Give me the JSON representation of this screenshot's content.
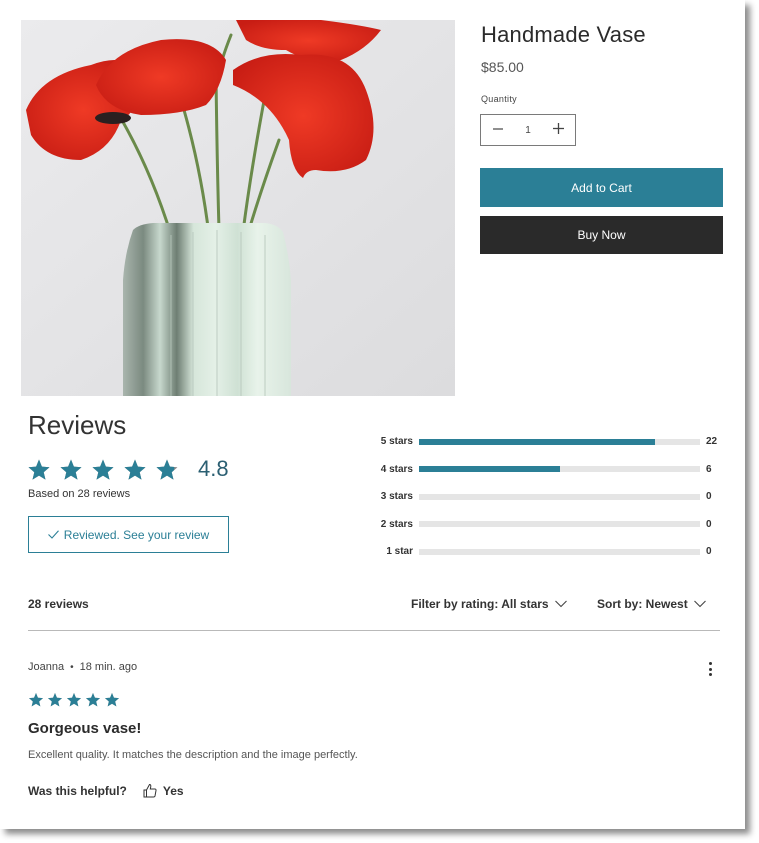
{
  "product": {
    "image_alt": "Red poppies in a pale green ribbed ceramic vase",
    "title": "Handmade Vase",
    "price": "$85.00",
    "quantity_label": "Quantity",
    "quantity_value": "1",
    "decrement_icon": "minus-icon",
    "increment_icon": "plus-icon",
    "add_to_cart_label": "Add to Cart",
    "buy_now_label": "Buy Now"
  },
  "reviews_summary": {
    "heading": "Reviews",
    "average_rating": "4.8",
    "average_rating_value": 4.8,
    "max_rating": 5,
    "based_on": "Based on 28 reviews",
    "reviewed_button_label": "Reviewed. See your review",
    "reviewed_icon": "check-icon",
    "histogram": [
      {
        "label": "5 stars",
        "count": "22",
        "fill_fraction": 0.84
      },
      {
        "label": "4 stars",
        "count": "6",
        "fill_fraction": 0.5
      },
      {
        "label": "3 stars",
        "count": "0",
        "fill_fraction": 0
      },
      {
        "label": "2 stars",
        "count": "0",
        "fill_fraction": 0
      },
      {
        "label": "1 star",
        "count": "0",
        "fill_fraction": 0
      }
    ]
  },
  "toolbar": {
    "reviews_count": "28 reviews",
    "filter_label": "Filter by rating: All stars",
    "sort_label": "Sort by: Newest"
  },
  "reviews": [
    {
      "author": "Joanna",
      "separator": "•",
      "time_ago": "18 min. ago",
      "rating": 5,
      "title": "Gorgeous vase!",
      "body": "Excellent quality. It matches the description and the image perfectly.",
      "helpful_label": "Was this helpful?",
      "yes_label": "Yes",
      "menu_icon": "more-vertical-icon"
    }
  ],
  "colors": {
    "accent": "#2b7f96",
    "buy_now": "#2a2a2a",
    "star_empty": "#8a8a8a",
    "track": "#e5e5e5",
    "avg_text": "#2b5f72"
  }
}
